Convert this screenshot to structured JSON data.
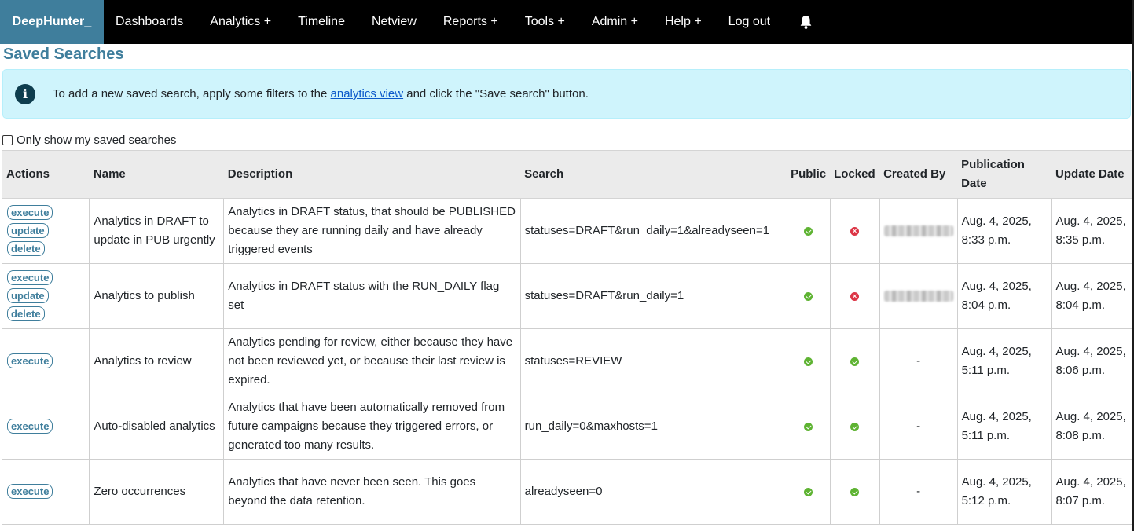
{
  "navbar": {
    "brand": "DeepHunter_",
    "items": [
      "Dashboards",
      "Analytics +",
      "Timeline",
      "Netview",
      "Reports +",
      "Tools +",
      "Admin +",
      "Help +",
      "Log out"
    ]
  },
  "page": {
    "title": "Saved Searches"
  },
  "alert": {
    "text_before": "To add a new saved search, apply some filters to the ",
    "link": "analytics view",
    "text_after": " and click the \"Save search\" button."
  },
  "filter": {
    "label": "Only show my saved searches",
    "checked": false
  },
  "table": {
    "headers": [
      "Actions",
      "Name",
      "Description",
      "Search",
      "Public",
      "Locked",
      "Created By",
      "Publication Date",
      "Update Date"
    ],
    "buttons": {
      "execute": "execute",
      "update": "update",
      "delete": "delete"
    },
    "rows": [
      {
        "name": "Analytics in DRAFT to update in PUB urgently",
        "description": "Analytics in DRAFT status, that should be PUBLISHED because they are running daily and have already triggered events",
        "search": "statuses=DRAFT&run_daily=1&alreadyseen=1",
        "public": true,
        "locked": false,
        "created_by": "",
        "publication_date": "Aug. 4, 2025, 8:33 p.m.",
        "update_date": "Aug. 4, 2025, 8:35 p.m."
      },
      {
        "name": "Analytics to publish",
        "description": "Analytics in DRAFT status with the RUN_DAILY flag set",
        "search": "statuses=DRAFT&run_daily=1",
        "public": true,
        "locked": false,
        "created_by": "",
        "publication_date": "Aug. 4, 2025, 8:04 p.m.",
        "update_date": "Aug. 4, 2025, 8:04 p.m."
      },
      {
        "name": "Analytics to review",
        "description": "Analytics pending for review, either because they have not been reviewed yet, or because their last review is expired.",
        "search": "statuses=REVIEW",
        "public": true,
        "locked": true,
        "created_by": "-",
        "publication_date": "Aug. 4, 2025, 5:11 p.m.",
        "update_date": "Aug. 4, 2025, 8:06 p.m."
      },
      {
        "name": "Auto-disabled analytics",
        "description": "Analytics that have been automatically removed from future campaigns because they triggered errors, or generated too many results.",
        "search": "run_daily=0&maxhosts=1",
        "public": true,
        "locked": true,
        "created_by": "-",
        "publication_date": "Aug. 4, 2025, 5:11 p.m.",
        "update_date": "Aug. 4, 2025, 8:08 p.m."
      },
      {
        "name": "Zero occurrences",
        "description": "Analytics that have never been seen. This goes beyond the data retention.",
        "search": "alreadyseen=0",
        "public": true,
        "locked": true,
        "created_by": "-",
        "publication_date": "Aug. 4, 2025, 5:12 p.m.",
        "update_date": "Aug. 4, 2025, 8:07 p.m."
      }
    ]
  },
  "colors": {
    "brand": "#3f7e9c",
    "navbar": "#000000",
    "alert_bg": "#cff4fc",
    "ok": "#5eb332",
    "no": "#dc3545"
  },
  "icons": {
    "alert": "info-circle-icon",
    "navbar_bell": "bell-icon",
    "public_true": "check-circle-icon",
    "locked_false": "x-circle-icon"
  }
}
